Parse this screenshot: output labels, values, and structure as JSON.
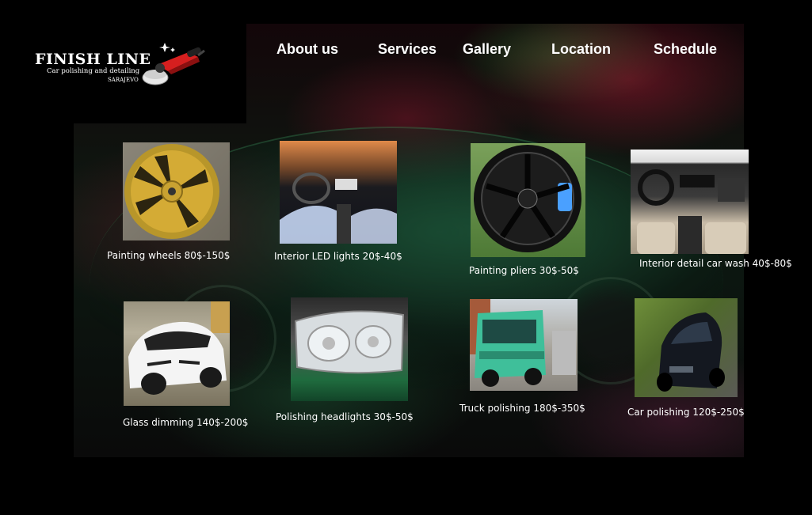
{
  "brand": {
    "name": "FINISH LINE",
    "tagline": "Car polishing and detailing",
    "city": "SARAJEVO",
    "logo_icon": "polisher-icon"
  },
  "nav": {
    "about": "About us",
    "services": "Services",
    "gallery": "Gallery",
    "location": "Location",
    "schedule": "Schedule"
  },
  "services": [
    {
      "caption": "Painting wheels 80$-150$",
      "image": "gold-wheel-photo"
    },
    {
      "caption": "Interior LED lights 20$-40$",
      "image": "led-interior-photo"
    },
    {
      "caption": "Painting pliers 30$-50$",
      "image": "black-rim-photo"
    },
    {
      "caption": "Interior detail car wash 40$-80$",
      "image": "car-interior-photo"
    },
    {
      "caption": "Glass dimming 140$-200$",
      "image": "white-peugeot-photo"
    },
    {
      "caption": "Polishing headlights 30$-50$",
      "image": "headlight-photo"
    },
    {
      "caption": "Truck polishing 180$-350$",
      "image": "green-truck-photo"
    },
    {
      "caption": "Car polishing 120$-250$",
      "image": "black-suv-photo"
    }
  ],
  "colors": {
    "background": "#000000",
    "text": "#ffffff",
    "accent_red": "#d61f1f"
  }
}
